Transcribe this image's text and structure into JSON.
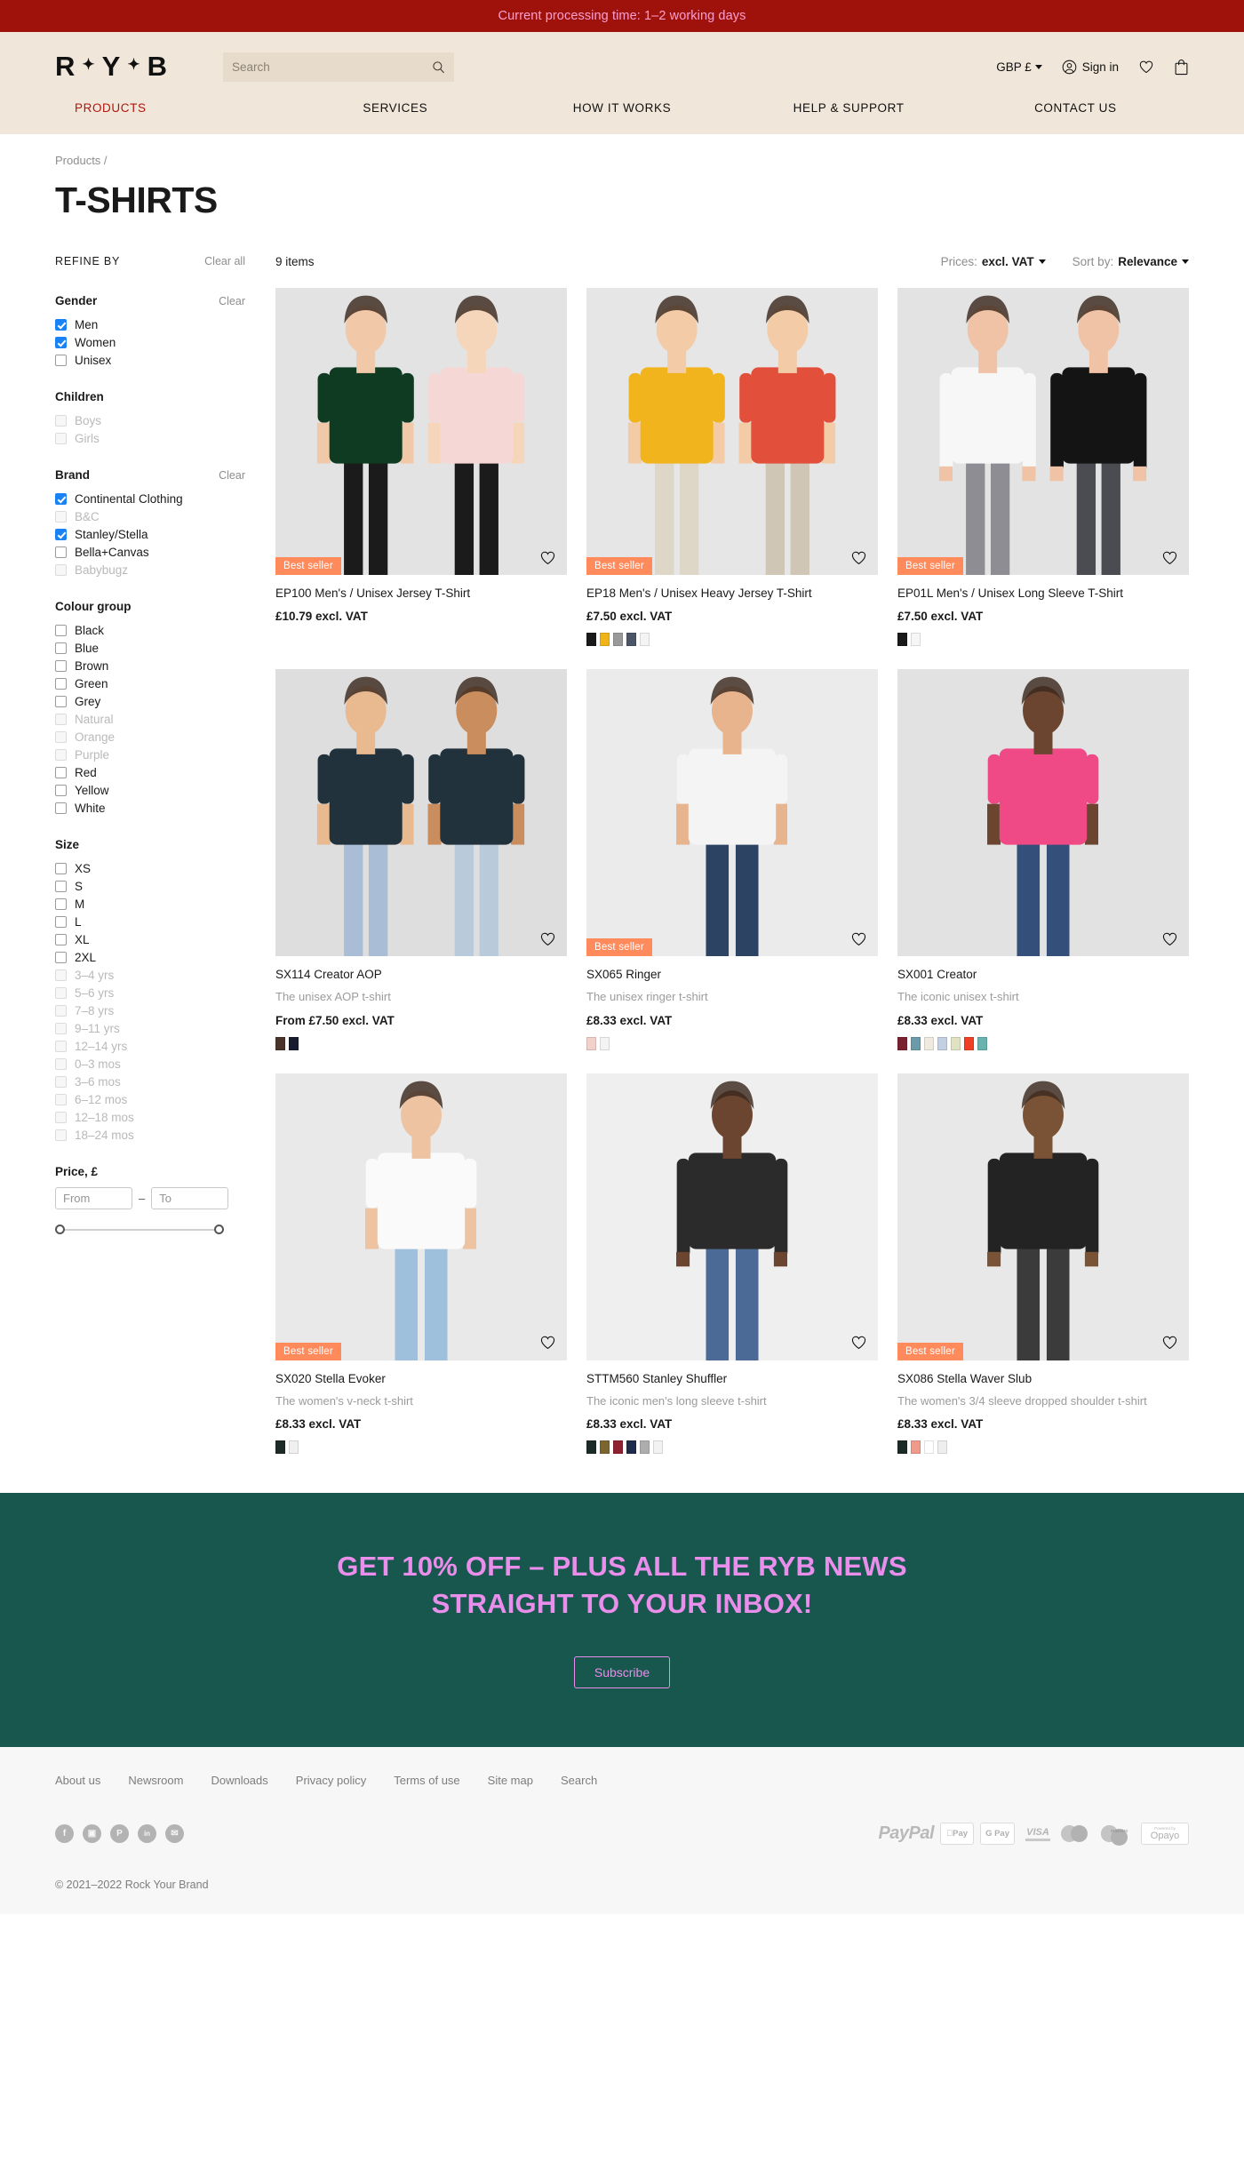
{
  "announcement": "Current processing time: 1–2 working days",
  "header": {
    "logo_parts": [
      "R",
      "Y",
      "B"
    ],
    "search_placeholder": "Search",
    "search_value": "",
    "currency": "GBP £",
    "signin": "Sign in",
    "nav": [
      {
        "label": "PRODUCTS",
        "active": true
      },
      {
        "label": "SERVICES",
        "active": false
      },
      {
        "label": "HOW IT WORKS",
        "active": false
      },
      {
        "label": "HELP & SUPPORT",
        "active": false
      },
      {
        "label": "CONTACT US",
        "active": false
      }
    ]
  },
  "breadcrumb": "Products  /",
  "page_title": "T-SHIRTS",
  "sidebar": {
    "refine_label": "REFINE BY",
    "clear_all": "Clear all",
    "groups": [
      {
        "title": "Gender",
        "clear": "Clear",
        "options": [
          {
            "label": "Men",
            "checked": true,
            "disabled": false
          },
          {
            "label": "Women",
            "checked": true,
            "disabled": false
          },
          {
            "label": "Unisex",
            "checked": false,
            "disabled": false
          }
        ]
      },
      {
        "title": "Children",
        "clear": "",
        "options": [
          {
            "label": "Boys",
            "checked": false,
            "disabled": true
          },
          {
            "label": "Girls",
            "checked": false,
            "disabled": true
          }
        ]
      },
      {
        "title": "Brand",
        "clear": "Clear",
        "options": [
          {
            "label": "Continental Clothing",
            "checked": true,
            "disabled": false
          },
          {
            "label": "B&C",
            "checked": false,
            "disabled": true
          },
          {
            "label": "Stanley/Stella",
            "checked": true,
            "disabled": false
          },
          {
            "label": "Bella+Canvas",
            "checked": false,
            "disabled": false
          },
          {
            "label": "Babybugz",
            "checked": false,
            "disabled": true
          }
        ]
      },
      {
        "title": "Colour group",
        "clear": "",
        "options": [
          {
            "label": "Black",
            "checked": false,
            "disabled": false
          },
          {
            "label": "Blue",
            "checked": false,
            "disabled": false
          },
          {
            "label": "Brown",
            "checked": false,
            "disabled": false
          },
          {
            "label": "Green",
            "checked": false,
            "disabled": false
          },
          {
            "label": "Grey",
            "checked": false,
            "disabled": false
          },
          {
            "label": "Natural",
            "checked": false,
            "disabled": true
          },
          {
            "label": "Orange",
            "checked": false,
            "disabled": true
          },
          {
            "label": "Purple",
            "checked": false,
            "disabled": true
          },
          {
            "label": "Red",
            "checked": false,
            "disabled": false
          },
          {
            "label": "Yellow",
            "checked": false,
            "disabled": false
          },
          {
            "label": "White",
            "checked": false,
            "disabled": false
          }
        ]
      },
      {
        "title": "Size",
        "clear": "",
        "options": [
          {
            "label": "XS",
            "checked": false,
            "disabled": false
          },
          {
            "label": "S",
            "checked": false,
            "disabled": false
          },
          {
            "label": "M",
            "checked": false,
            "disabled": false
          },
          {
            "label": "L",
            "checked": false,
            "disabled": false
          },
          {
            "label": "XL",
            "checked": false,
            "disabled": false
          },
          {
            "label": "2XL",
            "checked": false,
            "disabled": false
          },
          {
            "label": "3–4 yrs",
            "checked": false,
            "disabled": true
          },
          {
            "label": "5–6 yrs",
            "checked": false,
            "disabled": true
          },
          {
            "label": "7–8 yrs",
            "checked": false,
            "disabled": true
          },
          {
            "label": "9–11 yrs",
            "checked": false,
            "disabled": true
          },
          {
            "label": "12–14 yrs",
            "checked": false,
            "disabled": true
          },
          {
            "label": "0–3 mos",
            "checked": false,
            "disabled": true
          },
          {
            "label": "3–6 mos",
            "checked": false,
            "disabled": true
          },
          {
            "label": "6–12 mos",
            "checked": false,
            "disabled": true
          },
          {
            "label": "12–18 mos",
            "checked": false,
            "disabled": true
          },
          {
            "label": "18–24 mos",
            "checked": false,
            "disabled": true
          }
        ]
      }
    ],
    "price": {
      "title": "Price, £",
      "from_placeholder": "From",
      "from_value": "",
      "to_placeholder": "To",
      "to_value": "",
      "separator": "–"
    }
  },
  "toolbar": {
    "item_count": "9 items",
    "prices_label": "Prices:",
    "prices_value": "excl. VAT",
    "sort_label": "Sort by:",
    "sort_value": "Relevance"
  },
  "badge_label": "Best seller",
  "products": [
    {
      "title": "EP100 Men's / Unisex Jersey T-Shirt",
      "subtitle": "",
      "price": "£10.79 excl. VAT",
      "best_seller": true,
      "swatches": [],
      "image_kind": "pair-green-pink"
    },
    {
      "title": "EP18 Men's / Unisex Heavy Jersey T-Shirt",
      "subtitle": "",
      "price": "£7.50 excl. VAT",
      "best_seller": true,
      "swatches": [
        "#1a1a1a",
        "#f0b419",
        "#9a9a9a",
        "#4a5568",
        "#f4f4f4"
      ],
      "image_kind": "pair-yellow-red"
    },
    {
      "title": "EP01L Men's / Unisex Long Sleeve T-Shirt",
      "subtitle": "",
      "price": "£7.50 excl. VAT",
      "best_seller": true,
      "swatches": [
        "#1a1a1a",
        "#f6f6f6"
      ],
      "image_kind": "pair-white-black"
    },
    {
      "title": "SX114 Creator AOP",
      "subtitle": "The unisex AOP t-shirt",
      "price": "From £7.50 excl. VAT",
      "best_seller": false,
      "swatches": [
        "#4a332b",
        "#161b2e"
      ],
      "image_kind": "pair-floral"
    },
    {
      "title": "SX065 Ringer",
      "subtitle": "The unisex ringer t-shirt",
      "price": "£8.33 excl. VAT",
      "best_seller": true,
      "swatches": [
        "#f2d0cc",
        "#f4f4f4"
      ],
      "image_kind": "single-ringer"
    },
    {
      "title": "SX001 Creator",
      "subtitle": "The iconic unisex t-shirt",
      "price": "£8.33 excl. VAT",
      "best_seller": false,
      "swatches": [
        "#7a2130",
        "#6b9aa8",
        "#eeeae0",
        "#c3cfe2",
        "#e0e2c4",
        "#ef4023",
        "#69b2ae"
      ],
      "image_kind": "single-pink"
    },
    {
      "title": "SX020 Stella Evoker",
      "subtitle": "The women's v-neck t-shirt",
      "price": "£8.33 excl. VAT",
      "best_seller": true,
      "swatches": [
        "#1d2b28",
        "#f0f0f0"
      ],
      "image_kind": "single-white-vneck"
    },
    {
      "title": "STTM560 Stanley Shuffler",
      "subtitle": "The iconic men's long sleeve t-shirt",
      "price": "£8.33 excl. VAT",
      "best_seller": false,
      "swatches": [
        "#1d2b28",
        "#7d6530",
        "#8f2230",
        "#1e2b4a",
        "#adadad",
        "#f2f2f2"
      ],
      "image_kind": "single-black-long"
    },
    {
      "title": "SX086 Stella Waver Slub",
      "subtitle": "The women's 3/4 sleeve dropped shoulder t-shirt",
      "price": "£8.33 excl. VAT",
      "best_seller": true,
      "swatches": [
        "#1d2b28",
        "#f09a8b",
        "#ffffff",
        "#eeeeee"
      ],
      "image_kind": "single-black-34"
    }
  ],
  "newsletter": {
    "title": "GET 10% OFF – PLUS ALL THE RYB NEWS STRAIGHT TO YOUR INBOX!",
    "button": "Subscribe"
  },
  "footer": {
    "links": [
      "About us",
      "Newsroom",
      "Downloads",
      "Privacy policy",
      "Terms of use",
      "Site map",
      "Search"
    ],
    "socials": [
      "facebook-icon",
      "instagram-icon",
      "pinterest-icon",
      "linkedin-icon",
      "email-icon"
    ],
    "payments": {
      "paypal": "PayPal",
      "apple_pay": "Pay",
      "google_pay": "G Pay",
      "visa": "VISA",
      "maestro": "maestro",
      "opayo_powered": "Powered by",
      "opayo": "Opayo"
    },
    "copyright": "© 2021–2022 Rock Your Brand"
  }
}
